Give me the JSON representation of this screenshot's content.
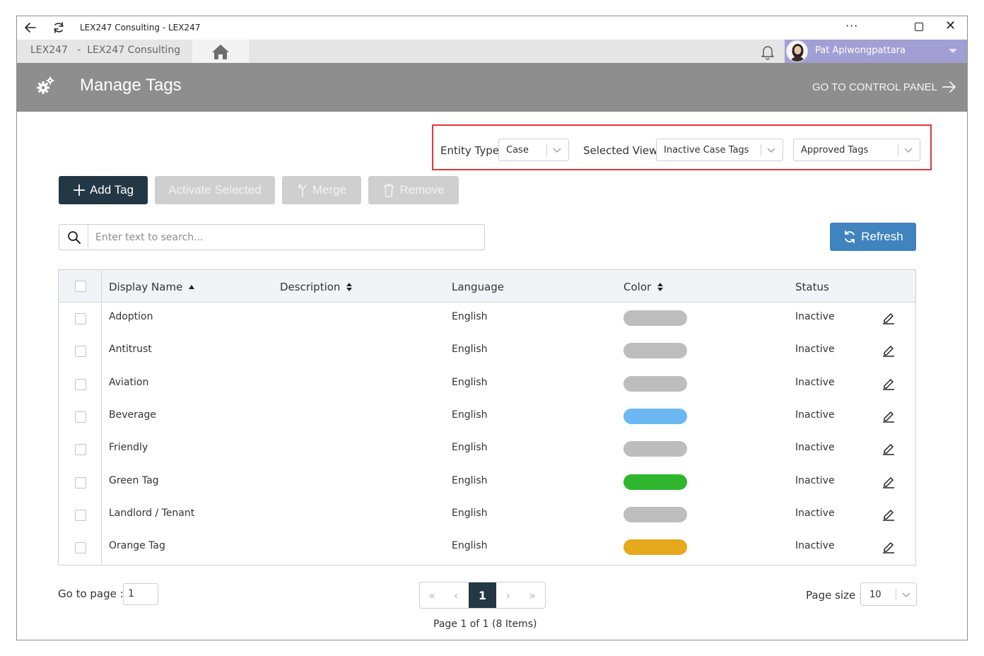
{
  "window": {
    "title": "LEX247 Consulting - LEX247",
    "more_glyph": "···",
    "close_glyph": "✕"
  },
  "nav": {
    "breadcrumb": "LEX247   -  LEX247 Consulting",
    "user_name": "Pat Apiwongpattara"
  },
  "header": {
    "title": "Manage Tags",
    "control_panel_link": "GO TO CONTROL PANEL"
  },
  "filters": {
    "entity_type_label": "Entity Type",
    "entity_type_value": "Case",
    "selected_view_label": "Selected View",
    "selected_view_value": "Inactive Case Tags",
    "approval_value": "Approved Tags"
  },
  "toolbar": {
    "add_tag": "Add Tag",
    "activate_selected": "Activate Selected",
    "merge": "Merge",
    "remove": "Remove",
    "refresh": "Refresh"
  },
  "search": {
    "placeholder": "Enter text to search..."
  },
  "grid": {
    "columns": {
      "display_name": "Display Name",
      "description": "Description",
      "language": "Language",
      "color": "Color",
      "status": "Status"
    },
    "rows": [
      {
        "name": "Adoption",
        "description": "",
        "language": "English",
        "color": "#bdbdbd",
        "status": "Inactive"
      },
      {
        "name": "Antitrust",
        "description": "",
        "language": "English",
        "color": "#bdbdbd",
        "status": "Inactive"
      },
      {
        "name": "Aviation",
        "description": "",
        "language": "English",
        "color": "#bdbdbd",
        "status": "Inactive"
      },
      {
        "name": "Beverage",
        "description": "",
        "language": "English",
        "color": "#6cb8f2",
        "status": "Inactive"
      },
      {
        "name": "Friendly",
        "description": "",
        "language": "English",
        "color": "#bdbdbd",
        "status": "Inactive"
      },
      {
        "name": "Green Tag",
        "description": "",
        "language": "English",
        "color": "#2fb62f",
        "status": "Inactive"
      },
      {
        "name": "Landlord / Tenant",
        "description": "",
        "language": "English",
        "color": "#bdbdbd",
        "status": "Inactive"
      },
      {
        "name": "Orange Tag",
        "description": "",
        "language": "English",
        "color": "#e6a91c",
        "status": "Inactive"
      }
    ]
  },
  "pager": {
    "goto_label": "Go to page :",
    "goto_value": "1",
    "first_glyph": "«",
    "prev_glyph": "‹",
    "current_page": "1",
    "next_glyph": "›",
    "last_glyph": "»",
    "info": "Page 1 of 1 (8 Items)",
    "page_size_label": "Page size :",
    "page_size_value": "10"
  },
  "colors": {
    "header_bg": "#8e8e8e",
    "primary_dark": "#233744",
    "refresh_blue": "#3f83bf",
    "user_bar": "#a29fd4",
    "highlight_red": "#e0383e"
  },
  "icons": [
    "back-arrow-icon",
    "reload-icon",
    "home-icon",
    "bell-icon",
    "gears-icon",
    "arrow-right-icon",
    "chevron-down-icon",
    "plus-icon",
    "merge-icon",
    "trash-icon",
    "refresh-icon",
    "search-icon",
    "sort-asc-icon",
    "sort-icon",
    "pencil-icon"
  ]
}
